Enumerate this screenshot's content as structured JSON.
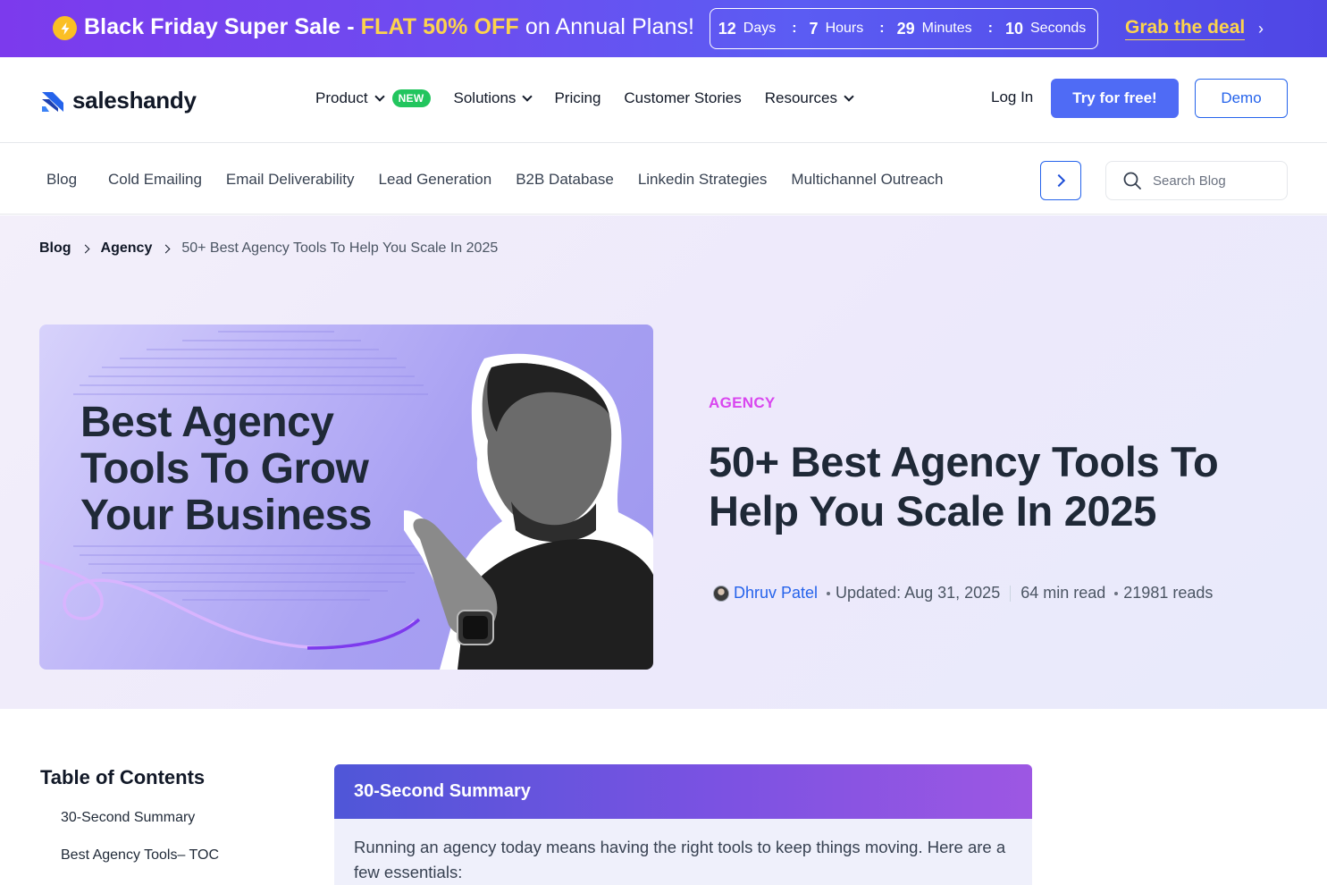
{
  "promo": {
    "headline_start": "Black Friday Super Sale - ",
    "headline_highlight": "FLAT 50% OFF",
    "headline_end": " on Annual Plans!",
    "countdown": [
      {
        "value": "12",
        "unit": "Days"
      },
      {
        "value": "7",
        "unit": "Hours"
      },
      {
        "value": "29",
        "unit": "Minutes"
      },
      {
        "value": "10",
        "unit": "Seconds"
      }
    ],
    "cta": "Grab the deal",
    "colors": {
      "banner_start": "#7c3aed",
      "banner_end": "#4f46e5",
      "highlight": "#fcd34d"
    }
  },
  "nav": {
    "logo_text": "saleshandy",
    "items": [
      {
        "label": "Product",
        "dropdown": true,
        "badge": "NEW"
      },
      {
        "label": "Solutions",
        "dropdown": true
      },
      {
        "label": "Pricing",
        "dropdown": false
      },
      {
        "label": "Customer Stories",
        "dropdown": false
      },
      {
        "label": "Resources",
        "dropdown": true
      }
    ],
    "login": "Log In",
    "try_free": "Try for free!",
    "demo": "Demo",
    "colors": {
      "primary": "#4f6bf5",
      "badge": "#22c55e"
    }
  },
  "categories": {
    "items": [
      "Blog",
      "Cold Emailing",
      "Email Deliverability",
      "Lead Generation",
      "B2B Database",
      "Linkedin Strategies",
      "Multichannel Outreach"
    ],
    "search_placeholder": "Search Blog"
  },
  "breadcrumb": [
    "Blog",
    "Agency",
    "50+ Best Agency Tools To Help You Scale In 2025"
  ],
  "hero": {
    "image_title": "Best Agency Tools To Grow Your Business",
    "category": "AGENCY",
    "title": "50+ Best Agency Tools To Help You Scale In 2025",
    "author": "Dhruv Patel",
    "updated": "Updated: Aug 31, 2025",
    "read_time": "64 min read",
    "reads": "21981 reads",
    "colors": {
      "category": "#d946ef",
      "author": "#2563eb"
    }
  },
  "toc": {
    "title": "Table of Contents",
    "items": [
      "30-Second Summary",
      "Best Agency Tools– TOC"
    ]
  },
  "summary": {
    "title": "30-Second Summary",
    "body": "Running an agency today means having the right tools to keep things moving. Here are a few essentials:"
  }
}
